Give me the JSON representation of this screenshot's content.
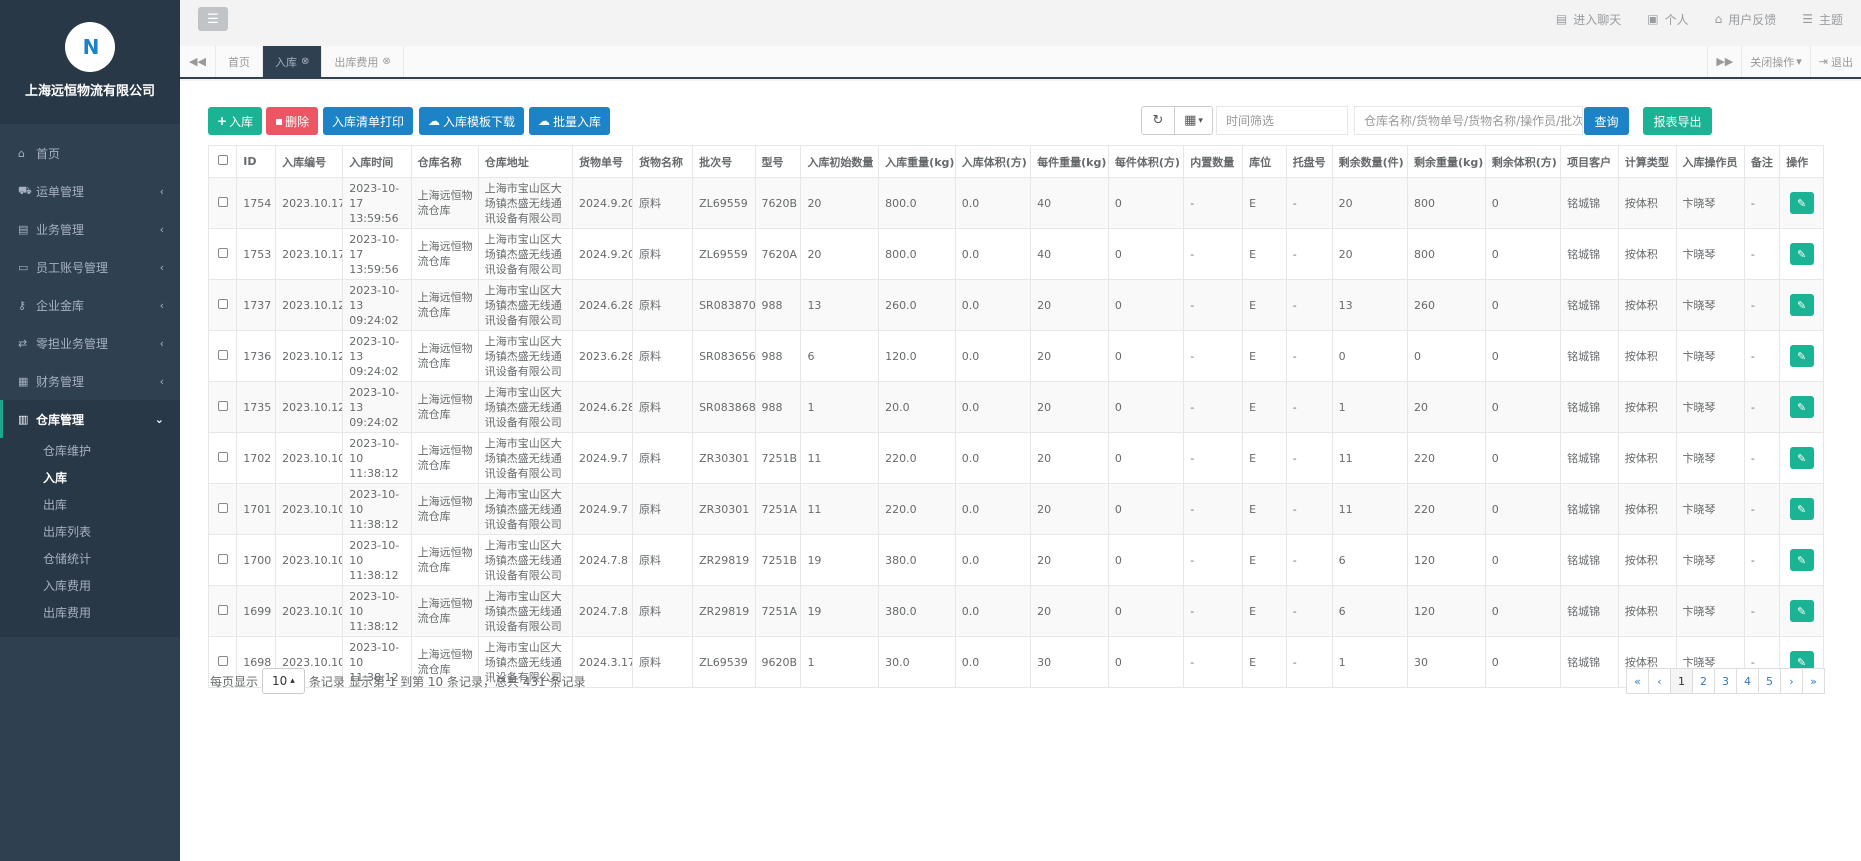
{
  "sidebar": {
    "logo_text": "N",
    "company": "上海远恒物流有限公司",
    "items": [
      {
        "label": "首页",
        "icon": "⌂"
      },
      {
        "label": "运单管理",
        "icon": "⛟"
      },
      {
        "label": "业务管理",
        "icon": "▤"
      },
      {
        "label": "员工账号管理",
        "icon": "▭"
      },
      {
        "label": "企业金库",
        "icon": "⚷"
      },
      {
        "label": "零担业务管理",
        "icon": "⇄"
      },
      {
        "label": "财务管理",
        "icon": "▦"
      },
      {
        "label": "仓库管理",
        "icon": "▥"
      }
    ],
    "subitems": [
      "仓库维护",
      "入库",
      "出库",
      "出库列表",
      "仓储统计",
      "入库费用",
      "出库费用"
    ],
    "current_sub": "入库"
  },
  "topbar": {
    "menu_icon": "☰",
    "items": [
      {
        "label": "进入聊天",
        "icon": "▤"
      },
      {
        "label": "个人",
        "icon": "▣"
      },
      {
        "label": "用户反馈",
        "icon": "⌂"
      },
      {
        "label": "主题",
        "icon": "☰"
      }
    ]
  },
  "tabs": {
    "items": [
      {
        "label": "首页",
        "closable": false
      },
      {
        "label": "入库",
        "closable": true,
        "active": true
      },
      {
        "label": "出库费用",
        "closable": true
      }
    ],
    "close_ops": "关闭操作",
    "logout": "退出"
  },
  "toolbar": {
    "add": "入库",
    "delete": "删除",
    "print": "入库清单打印",
    "template": "入库模板下载",
    "batch": "批量入库",
    "time_placeholder": "时间筛选",
    "search_placeholder": "仓库名称/货物单号/货物名称/操作员/批次号/型号",
    "query": "查询",
    "export": "报表导出"
  },
  "colors": {
    "green": "#1ab394",
    "red": "#ed5565",
    "blue": "#1c84c6",
    "sidebar": "#2f4050"
  },
  "table": {
    "headers": [
      "ID",
      "入库编号",
      "入库时间",
      "仓库名称",
      "仓库地址",
      "货物单号",
      "货物名称",
      "批次号",
      "型号",
      "入库初始数量",
      "入库重量(kg)",
      "入库体积(方)",
      "每件重量(kg)",
      "每件体积(方)",
      "内置数量",
      "库位",
      "托盘号",
      "剩余数量(件)",
      "剩余重量(kg)",
      "剩余体积(方)",
      "项目客户",
      "计算类型",
      "入库操作员",
      "备注",
      "操作"
    ],
    "rows": [
      [
        "1754",
        "2023.10.17",
        "2023-10-17 13:59:56",
        "上海远恒物流仓库",
        "上海市宝山区大场镇杰盛无线通讯设备有限公司",
        "2024.9.20",
        "原料",
        "ZL69559",
        "7620B",
        "20",
        "800.0",
        "0.0",
        "40",
        "0",
        "-",
        "E",
        "-",
        "20",
        "800",
        "0",
        "铭城锦",
        "按体积",
        "卞晓琴",
        "-"
      ],
      [
        "1753",
        "2023.10.17",
        "2023-10-17 13:59:56",
        "上海远恒物流仓库",
        "上海市宝山区大场镇杰盛无线通讯设备有限公司",
        "2024.9.20",
        "原料",
        "ZL69559",
        "7620A",
        "20",
        "800.0",
        "0.0",
        "40",
        "0",
        "-",
        "E",
        "-",
        "20",
        "800",
        "0",
        "铭城锦",
        "按体积",
        "卞晓琴",
        "-"
      ],
      [
        "1737",
        "2023.10.12",
        "2023-10-13 09:24:02",
        "上海远恒物流仓库",
        "上海市宝山区大场镇杰盛无线通讯设备有限公司",
        "2024.6.28",
        "原料",
        "SR083870",
        "988",
        "13",
        "260.0",
        "0.0",
        "20",
        "0",
        "-",
        "E",
        "-",
        "13",
        "260",
        "0",
        "铭城锦",
        "按体积",
        "卞晓琴",
        "-"
      ],
      [
        "1736",
        "2023.10.12",
        "2023-10-13 09:24:02",
        "上海远恒物流仓库",
        "上海市宝山区大场镇杰盛无线通讯设备有限公司",
        "2023.6.28",
        "原料",
        "SR083656",
        "988",
        "6",
        "120.0",
        "0.0",
        "20",
        "0",
        "-",
        "E",
        "-",
        "0",
        "0",
        "0",
        "铭城锦",
        "按体积",
        "卞晓琴",
        "-"
      ],
      [
        "1735",
        "2023.10.12",
        "2023-10-13 09:24:02",
        "上海远恒物流仓库",
        "上海市宝山区大场镇杰盛无线通讯设备有限公司",
        "2024.6.28",
        "原料",
        "SR083868",
        "988",
        "1",
        "20.0",
        "0.0",
        "20",
        "0",
        "-",
        "E",
        "-",
        "1",
        "20",
        "0",
        "铭城锦",
        "按体积",
        "卞晓琴",
        "-"
      ],
      [
        "1702",
        "2023.10.10",
        "2023-10-10 11:38:12",
        "上海远恒物流仓库",
        "上海市宝山区大场镇杰盛无线通讯设备有限公司",
        "2024.9.7",
        "原料",
        "ZR30301",
        "7251B",
        "11",
        "220.0",
        "0.0",
        "20",
        "0",
        "-",
        "E",
        "-",
        "11",
        "220",
        "0",
        "铭城锦",
        "按体积",
        "卞晓琴",
        "-"
      ],
      [
        "1701",
        "2023.10.10",
        "2023-10-10 11:38:12",
        "上海远恒物流仓库",
        "上海市宝山区大场镇杰盛无线通讯设备有限公司",
        "2024.9.7",
        "原料",
        "ZR30301",
        "7251A",
        "11",
        "220.0",
        "0.0",
        "20",
        "0",
        "-",
        "E",
        "-",
        "11",
        "220",
        "0",
        "铭城锦",
        "按体积",
        "卞晓琴",
        "-"
      ],
      [
        "1700",
        "2023.10.10",
        "2023-10-10 11:38:12",
        "上海远恒物流仓库",
        "上海市宝山区大场镇杰盛无线通讯设备有限公司",
        "2024.7.8",
        "原料",
        "ZR29819",
        "7251B",
        "19",
        "380.0",
        "0.0",
        "20",
        "0",
        "-",
        "E",
        "-",
        "6",
        "120",
        "0",
        "铭城锦",
        "按体积",
        "卞晓琴",
        "-"
      ],
      [
        "1699",
        "2023.10.10",
        "2023-10-10 11:38:12",
        "上海远恒物流仓库",
        "上海市宝山区大场镇杰盛无线通讯设备有限公司",
        "2024.7.8",
        "原料",
        "ZR29819",
        "7251A",
        "19",
        "380.0",
        "0.0",
        "20",
        "0",
        "-",
        "E",
        "-",
        "6",
        "120",
        "0",
        "铭城锦",
        "按体积",
        "卞晓琴",
        "-"
      ],
      [
        "1698",
        "2023.10.10",
        "2023-10-10 11:38:12",
        "上海远恒物流仓库",
        "上海市宝山区大场镇杰盛无线通讯设备有限公司",
        "2024.3.17",
        "原料",
        "ZL69539",
        "9620B",
        "1",
        "30.0",
        "0.0",
        "30",
        "0",
        "-",
        "E",
        "-",
        "1",
        "30",
        "0",
        "铭城锦",
        "按体积",
        "卞晓琴",
        "-"
      ]
    ]
  },
  "footer": {
    "per_page_label": "每页显示",
    "page_size": "10",
    "records_unit": "条记录",
    "summary": "显示第 1 到第 10 条记录，总共 431 条记录"
  },
  "pagination": [
    "«",
    "‹",
    "1",
    "2",
    "3",
    "4",
    "5",
    "›",
    "»"
  ],
  "current_page": "1"
}
